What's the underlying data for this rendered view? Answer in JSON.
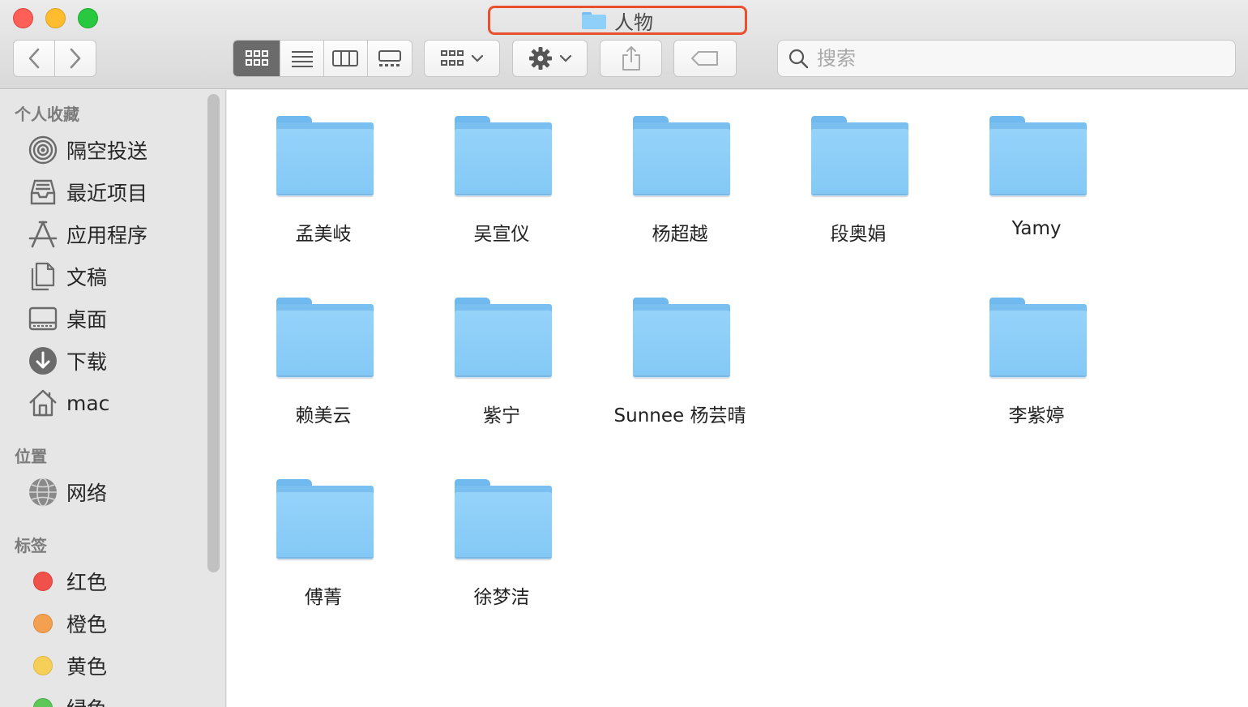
{
  "window": {
    "title": "人物"
  },
  "search": {
    "placeholder": "搜索",
    "value": ""
  },
  "sidebar": {
    "sections": {
      "favorites": "个人收藏",
      "locations": "位置",
      "tags": "标签"
    },
    "favorites": [
      {
        "label": "隔空投送",
        "icon": "airdrop-icon"
      },
      {
        "label": "最近项目",
        "icon": "recents-icon"
      },
      {
        "label": "应用程序",
        "icon": "applications-icon"
      },
      {
        "label": "文稿",
        "icon": "documents-icon"
      },
      {
        "label": "桌面",
        "icon": "desktop-icon"
      },
      {
        "label": "下载",
        "icon": "downloads-icon"
      },
      {
        "label": "mac",
        "icon": "home-icon"
      }
    ],
    "locations": [
      {
        "label": "网络",
        "icon": "network-icon"
      }
    ],
    "tags": [
      {
        "label": "红色",
        "color": "#f0514b"
      },
      {
        "label": "橙色",
        "color": "#f3a050"
      },
      {
        "label": "黄色",
        "color": "#f5cf58"
      },
      {
        "label": "绿色",
        "color": "#5dc75a"
      }
    ]
  },
  "folders": [
    {
      "name": "孟美岐"
    },
    {
      "name": "吴宣仪"
    },
    {
      "name": "杨超越"
    },
    {
      "name": "段奥娟"
    },
    {
      "name": "Yamy"
    },
    {
      "name": "赖美云"
    },
    {
      "name": "紫宁"
    },
    {
      "name": "Sunnee 杨芸晴"
    },
    {
      "name": "李紫婷"
    },
    {
      "name": "傅菁"
    },
    {
      "name": "徐梦洁"
    }
  ],
  "colors": {
    "folder": "#8fd0f8",
    "title_highlight": "#e8502e",
    "active_view": "#6b6b6b"
  }
}
